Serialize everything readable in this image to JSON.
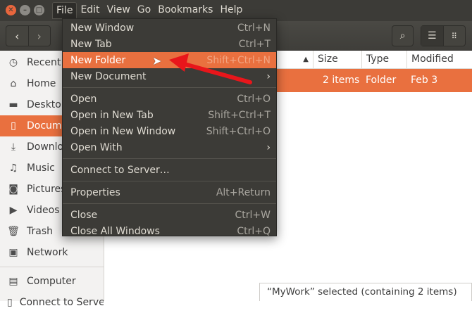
{
  "menubar": [
    "File",
    "Edit",
    "View",
    "Go",
    "Bookmarks",
    "Help"
  ],
  "file_menu": [
    {
      "label": "New Window",
      "shortcut": "Ctrl+N"
    },
    {
      "label": "New Tab",
      "shortcut": "Ctrl+T"
    },
    {
      "label": "New Folder",
      "shortcut": "Shift+Ctrl+N",
      "highlighted": true
    },
    {
      "label": "New Document",
      "submenu": true
    },
    {
      "label": "Open",
      "shortcut": "Ctrl+O"
    },
    {
      "label": "Open in New Tab",
      "shortcut": "Shift+Ctrl+T"
    },
    {
      "label": "Open in New Window",
      "shortcut": "Shift+Ctrl+O"
    },
    {
      "label": "Open With",
      "submenu": true
    },
    {
      "label": "Connect to Server…"
    },
    {
      "label": "Properties",
      "shortcut": "Alt+Return"
    },
    {
      "label": "Close",
      "shortcut": "Ctrl+W"
    },
    {
      "label": "Close All Windows",
      "shortcut": "Ctrl+Q"
    }
  ],
  "sidebar": [
    "Recent",
    "Home",
    "Desktop",
    "Documents",
    "Downloads",
    "Music",
    "Pictures",
    "Videos",
    "Trash",
    "Network",
    "Computer",
    "Connect to Server"
  ],
  "columns": {
    "size": "Size",
    "type": "Type",
    "modified": "Modified"
  },
  "row": {
    "size": "2 items",
    "type": "Folder",
    "modified": "Feb 3"
  },
  "status": "“MyWork” selected  (containing 2 items)",
  "accent": "#e9703f"
}
